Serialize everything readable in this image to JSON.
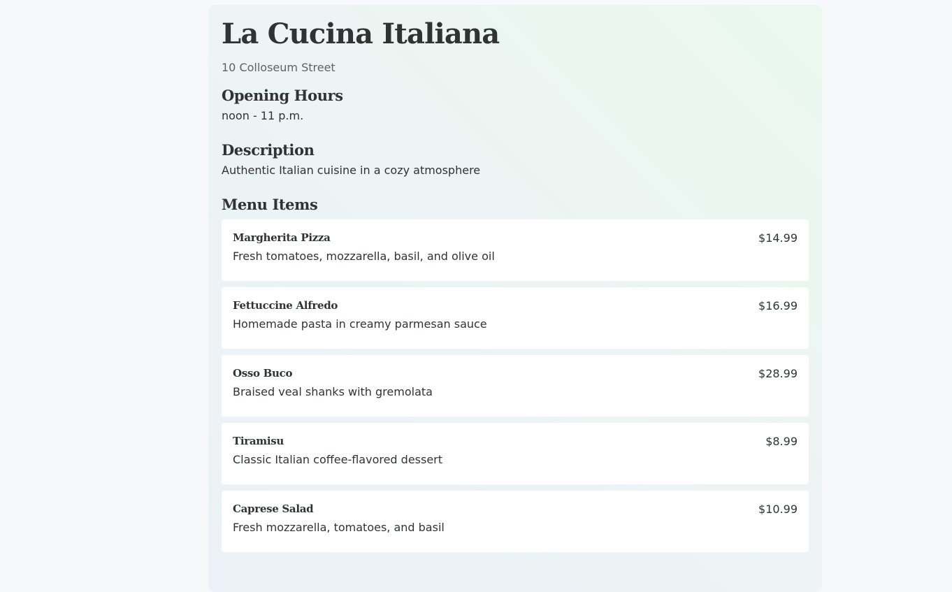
{
  "restaurant": {
    "name": "La Cucina Italiana",
    "address": "10 Colloseum Street"
  },
  "hours": {
    "heading": "Opening Hours",
    "text": "noon - 11 p.m."
  },
  "description": {
    "heading": "Description",
    "text": "Authentic Italian cuisine in a cozy atmosphere"
  },
  "menu": {
    "heading": "Menu Items",
    "items": [
      {
        "name": "Margherita Pizza",
        "description": "Fresh tomatoes, mozzarella, basil, and olive oil",
        "price": "$14.99"
      },
      {
        "name": "Fettuccine Alfredo",
        "description": "Homemade pasta in creamy parmesan sauce",
        "price": "$16.99"
      },
      {
        "name": "Osso Buco",
        "description": "Braised veal shanks with gremolata",
        "price": "$28.99"
      },
      {
        "name": "Tiramisu",
        "description": "Classic Italian coffee-flavored dessert",
        "price": "$8.99"
      },
      {
        "name": "Caprese Salad",
        "description": "Fresh mozzarella, tomatoes, and basil",
        "price": "$10.99"
      }
    ]
  }
}
